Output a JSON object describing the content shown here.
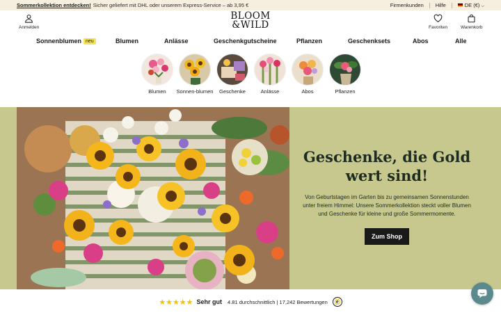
{
  "announcement": {
    "promo_link": "Sommerkollektion entdecken!",
    "promo_text": "Sicher geliefert mit DHL oder unserem Express-Service – ab 3,95 €",
    "links": [
      "Firmenkunden",
      "Hilfe"
    ],
    "locale": "DE (€)"
  },
  "header": {
    "login_label": "Anmelden",
    "logo_line1": "BLOOM",
    "logo_line2": "&WILD",
    "favorites_label": "Favoriten",
    "cart_label": "Warenkorb"
  },
  "nav": {
    "items": [
      "Sonnenblumen",
      "Blumen",
      "Anlässe",
      "Geschenkgutscheine",
      "Pflanzen",
      "Geschenksets",
      "Abos",
      "Alle"
    ],
    "new_badge": "neu"
  },
  "categories": [
    "Blumen",
    "Sonnen-blumen",
    "Geschenke",
    "Anlässe",
    "Abos",
    "Pflanzen"
  ],
  "hero": {
    "title_line1": "Geschenke, die Gold",
    "title_line2": "wert sind!",
    "body": "Von Geburtstagen im Garten bis zu gemeinsamen Sonnenstunden unter freiem Himmel: Unsere Sommerkollektion steckt voller Blumen und Geschenke für kleine und große Sommermomente.",
    "cta": "Zum Shop",
    "background_color": "#c6c88e"
  },
  "trust": {
    "stars": "★★★★★",
    "rating_word": "Sehr gut",
    "summary": "4.81 durchschnittlich | 17,242 Bewertungen",
    "seal": "e"
  },
  "icons": {
    "login": "user-icon",
    "favorites": "heart-icon",
    "cart": "bag-icon",
    "chat": "chat-icon"
  }
}
